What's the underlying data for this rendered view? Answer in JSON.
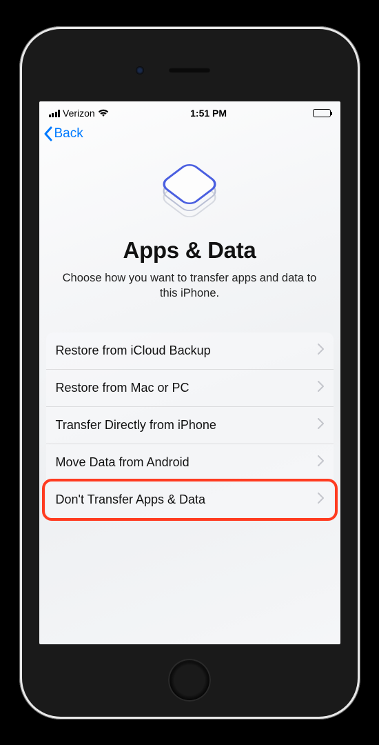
{
  "status": {
    "carrier": "Verizon",
    "time": "1:51 PM"
  },
  "nav": {
    "back_label": "Back"
  },
  "page": {
    "title": "Apps & Data",
    "subtitle": "Choose how you want to transfer apps and data to this iPhone."
  },
  "options": [
    {
      "label": "Restore from iCloud Backup",
      "highlight": false
    },
    {
      "label": "Restore from Mac or PC",
      "highlight": false
    },
    {
      "label": "Transfer Directly from iPhone",
      "highlight": false
    },
    {
      "label": "Move Data from Android",
      "highlight": false
    },
    {
      "label": "Don't Transfer Apps & Data",
      "highlight": true
    }
  ],
  "colors": {
    "accent": "#007aff",
    "highlight": "#ff3b20",
    "icon_primary": "#4a5fe0"
  }
}
